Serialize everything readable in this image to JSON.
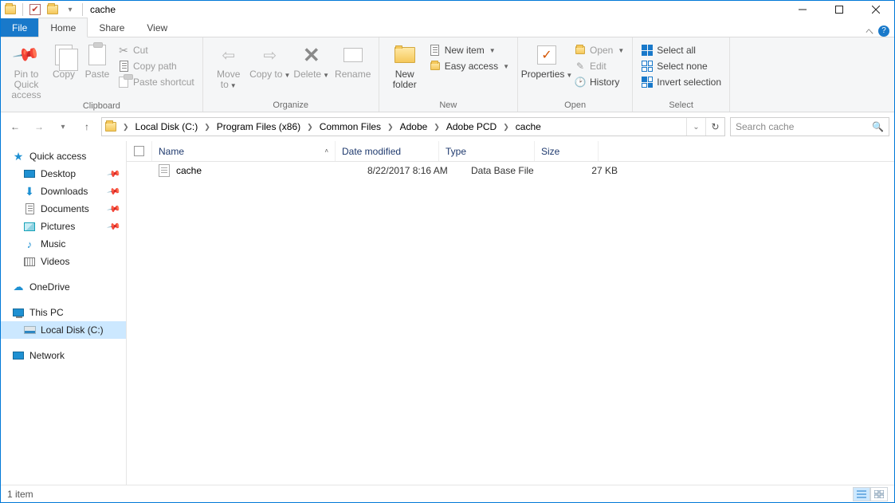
{
  "window": {
    "title": "cache",
    "qat_dropdown": "▾"
  },
  "tabs": {
    "file": "File",
    "home": "Home",
    "share": "Share",
    "view": "View"
  },
  "ribbon": {
    "clipboard": {
      "label": "Clipboard",
      "pin": "Pin to Quick access",
      "copy": "Copy",
      "paste": "Paste",
      "cut": "Cut",
      "copy_path": "Copy path",
      "paste_shortcut": "Paste shortcut"
    },
    "organize": {
      "label": "Organize",
      "move_to": "Move to",
      "copy_to": "Copy to",
      "delete": "Delete",
      "rename": "Rename"
    },
    "new": {
      "label": "New",
      "new_folder": "New folder",
      "new_item": "New item",
      "easy_access": "Easy access"
    },
    "open": {
      "label": "Open",
      "properties": "Properties",
      "open": "Open",
      "edit": "Edit",
      "history": "History"
    },
    "select": {
      "label": "Select",
      "select_all": "Select all",
      "select_none": "Select none",
      "invert": "Invert selection"
    }
  },
  "breadcrumb": [
    "Local Disk (C:)",
    "Program Files (x86)",
    "Common Files",
    "Adobe",
    "Adobe PCD",
    "cache"
  ],
  "search": {
    "placeholder": "Search cache"
  },
  "tree": {
    "quick_access": "Quick access",
    "desktop": "Desktop",
    "downloads": "Downloads",
    "documents": "Documents",
    "pictures": "Pictures",
    "music": "Music",
    "videos": "Videos",
    "onedrive": "OneDrive",
    "this_pc": "This PC",
    "local_disk": "Local Disk (C:)",
    "network": "Network"
  },
  "columns": {
    "name": "Name",
    "date": "Date modified",
    "type": "Type",
    "size": "Size"
  },
  "rows": [
    {
      "name": "cache",
      "date": "8/22/2017 8:16 AM",
      "type": "Data Base File",
      "size": "27 KB"
    }
  ],
  "status": {
    "count": "1 item"
  }
}
